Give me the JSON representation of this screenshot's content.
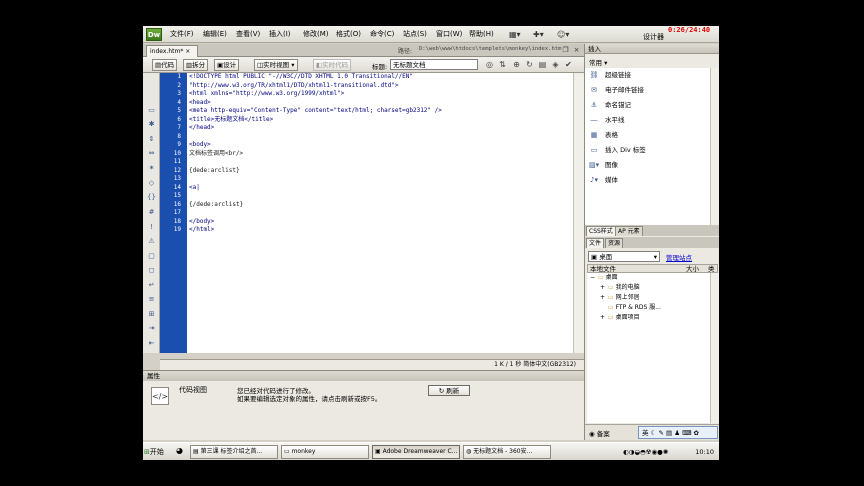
{
  "menubar": {
    "logo": "Dw",
    "items": [
      "文件(F)",
      "编辑(E)",
      "查看(V)",
      "插入(I)",
      "修改(M)",
      "格式(O)",
      "命令(C)",
      "站点(S)",
      "窗口(W)",
      "帮助(H)"
    ],
    "workspace": "设计器",
    "clock": "0:26/24:40"
  },
  "doc_tabs": {
    "tab": "index.htm*",
    "path_label": "路径:",
    "path": "D:\\web\\www\\htdocs\\templets\\monkey\\index.htm"
  },
  "doc_toolbar": {
    "code": "代码",
    "split": "拆分",
    "design": "设计",
    "live_view": "实时视图",
    "live_code": "实时代码",
    "title_label": "标题:",
    "title_value": "无标题文档"
  },
  "code": {
    "line_numbers": [
      "1",
      "2",
      "3",
      "4",
      "5",
      "6",
      "7",
      "8",
      "9",
      "10",
      "11",
      "12",
      "13",
      "14",
      "15",
      "16",
      "17",
      "18",
      "19"
    ],
    "lines": [
      "<!DOCTYPE html PUBLIC \"-//W3C//DTD XHTML 1.0 Transitional//EN\"",
      "\"http://www.w3.org/TR/xhtml1/DTD/xhtml1-transitional.dtd\">",
      "<html xmlns=\"http://www.w3.org/1999/xhtml\">",
      "<head>",
      "<meta http-equiv=\"Content-Type\" content=\"text/html; charset=gb2312\" />",
      "<title>无标题文档</title>",
      "</head>",
      "",
      "<body>",
      "文档标签调用<br/>",
      "",
      "{dede:arclist}",
      "",
      "<a|",
      "",
      "{/dede:arclist}",
      "",
      "</body>",
      "</html>"
    ]
  },
  "status": {
    "text": "1 K / 1 秒  简体中文(GB2312)"
  },
  "properties": {
    "title": "属性",
    "label": "代码视图",
    "message1": "您已经对代码进行了修改。",
    "message2": "如果要编辑选定对象的属性，请点击刷新或按F5。",
    "refresh": "刷新"
  },
  "insert_panel": {
    "title": "插入",
    "category": "常用",
    "items": [
      {
        "label": "超级链接",
        "icon": "link-icon"
      },
      {
        "label": "电子邮件链接",
        "icon": "email-icon"
      },
      {
        "label": "命名锚记",
        "icon": "anchor-icon"
      },
      {
        "label": "水平线",
        "icon": "hr-icon"
      },
      {
        "label": "表格",
        "icon": "table-icon"
      },
      {
        "label": "插入 Div 标签",
        "icon": "div-icon"
      },
      {
        "label": "图像",
        "icon": "image-icon"
      },
      {
        "label": "媒体",
        "icon": "media-icon"
      }
    ]
  },
  "css_tabs": [
    "CSS样式",
    "AP 元素"
  ],
  "files_panel": {
    "tabs": [
      "文件",
      "资源"
    ],
    "location": "桌面",
    "manage": "管理站点",
    "col_local": "本地文件",
    "col_size": "大小",
    "col_type": "类",
    "tree": [
      {
        "label": "桌面",
        "level": 0,
        "expander": "−"
      },
      {
        "label": "我的电脑",
        "level": 1,
        "expander": "+"
      },
      {
        "label": "网上邻居",
        "level": 1,
        "expander": "+"
      },
      {
        "label": "FTP & RDS 服...",
        "level": 1,
        "expander": ""
      },
      {
        "label": "桌面项目",
        "level": 1,
        "expander": "+"
      }
    ],
    "bottom_label": "备案"
  },
  "taskbar": {
    "start": "开始",
    "tasks": [
      "第三课 标签介绍之首...",
      "monkey",
      "Adobe Dreamweaver C...",
      "无标题文档 - 360安..."
    ],
    "ime": "英",
    "time": "10:10"
  }
}
